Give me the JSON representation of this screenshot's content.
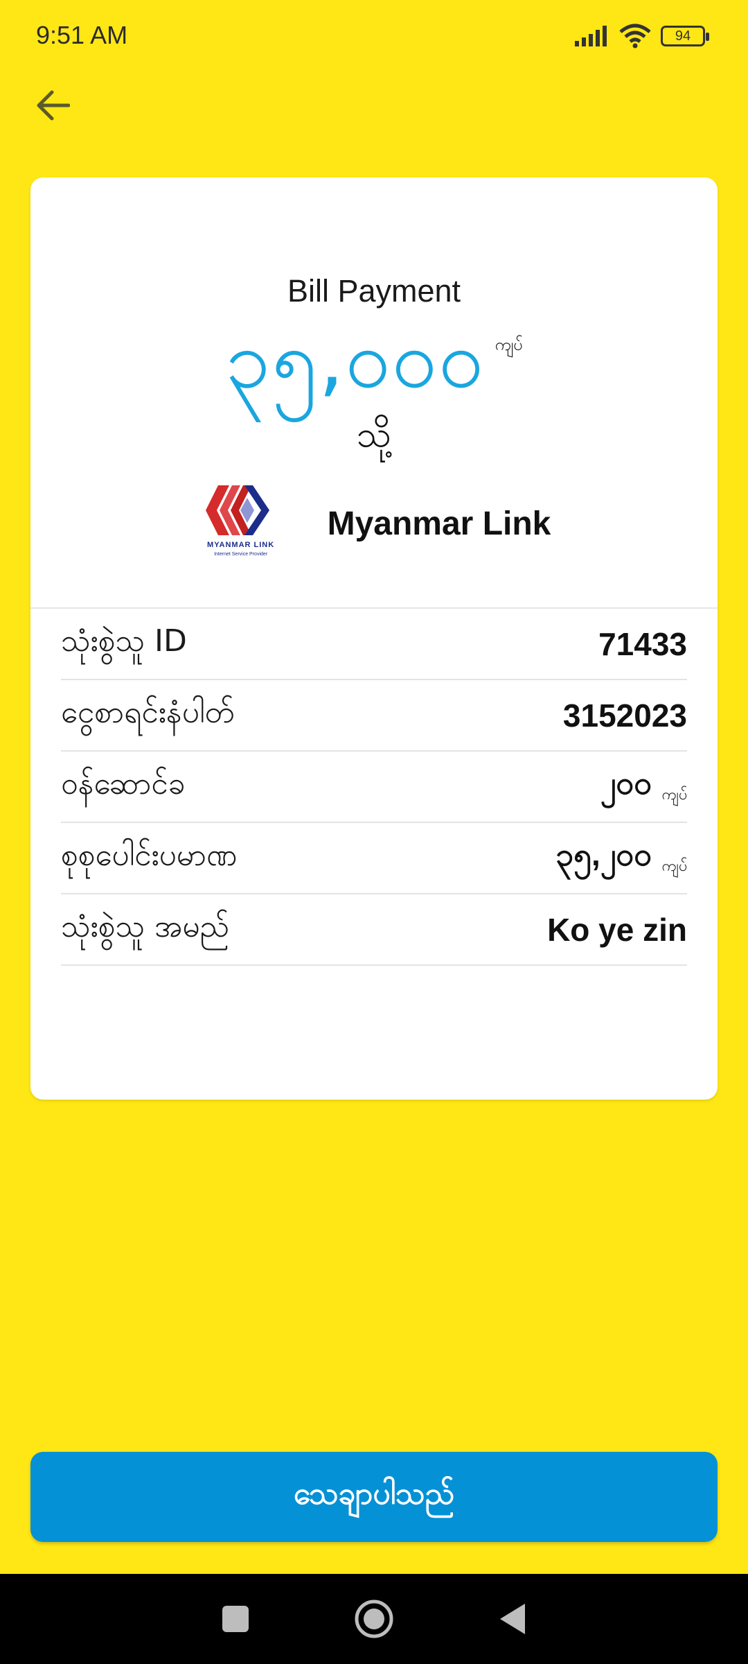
{
  "status_bar": {
    "time": "9:51 AM",
    "battery_level": "94"
  },
  "card": {
    "title": "Bill Payment",
    "amount": "၃၅,၀၀၀",
    "amount_unit": "ကျပ်",
    "to_label": "သို့",
    "merchant_name": "Myanmar Link",
    "logo_text": "MYANMAR LINK",
    "logo_subtext": "Internet Service Provider"
  },
  "details": [
    {
      "label": "သုံးစွဲသူ ID",
      "value": "71433",
      "unit": ""
    },
    {
      "label": "ငွေစာရင်းနံပါတ်",
      "value": "3152023",
      "unit": ""
    },
    {
      "label": "ဝန်ဆောင်ခ",
      "value": "၂၀၀",
      "unit": "ကျပ်"
    },
    {
      "label": "စုစုပေါင်းပမာဏ",
      "value": "၃၅,၂၀၀",
      "unit": "ကျပ်"
    },
    {
      "label": "သုံးစွဲသူ အမည်",
      "value": "Ko ye zin",
      "unit": ""
    }
  ],
  "confirm_button": {
    "label": "သေချာပါသည်"
  },
  "colors": {
    "background": "#FFE715",
    "amount": "#1AA6DF",
    "button": "#0591D6"
  }
}
